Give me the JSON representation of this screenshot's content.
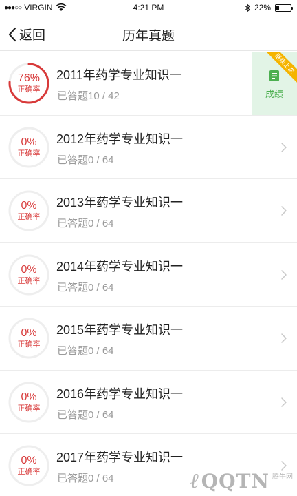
{
  "status_bar": {
    "signal": "●●●○○",
    "carrier": "VIRGIN",
    "time": "4:21 PM",
    "battery_label": "22%",
    "battery_level": 0.22
  },
  "nav": {
    "back_label": "返回",
    "title": "历年真题"
  },
  "items": [
    {
      "title": "2011年药学专业知识一",
      "answered": "已答题10 / 42",
      "accuracy": "76%",
      "accuracy_value": 0.76,
      "accuracy_label": "正确率"
    },
    {
      "title": "2012年药学专业知识一",
      "answered": "已答题0 / 64",
      "accuracy": "0%",
      "accuracy_value": 0,
      "accuracy_label": "正确率"
    },
    {
      "title": "2013年药学专业知识一",
      "answered": "已答题0 / 64",
      "accuracy": "0%",
      "accuracy_value": 0,
      "accuracy_label": "正确率"
    },
    {
      "title": "2014年药学专业知识一",
      "answered": "已答题0 / 64",
      "accuracy": "0%",
      "accuracy_value": 0,
      "accuracy_label": "正确率"
    },
    {
      "title": "2015年药学专业知识一",
      "answered": "已答题0 / 64",
      "accuracy": "0%",
      "accuracy_value": 0,
      "accuracy_label": "正确率"
    },
    {
      "title": "2016年药学专业知识一",
      "answered": "已答题0 / 64",
      "accuracy": "0%",
      "accuracy_value": 0,
      "accuracy_label": "正确率"
    },
    {
      "title": "2017年药学专业知识一",
      "answered": "已答题0 / 64",
      "accuracy": "0%",
      "accuracy_value": 0,
      "accuracy_label": "正确率"
    }
  ],
  "score_panel": {
    "label": "成绩",
    "ribbon": "继续上次",
    "icon": "report-icon"
  },
  "watermark": {
    "logo": "QQTN",
    "small": "腾牛网"
  },
  "colors": {
    "accent_red": "#d83a3a",
    "ring_track": "#eeeeee",
    "score_bg": "#e2f4e6",
    "score_green": "#4caf50",
    "ribbon_yellow": "#f5b400"
  }
}
